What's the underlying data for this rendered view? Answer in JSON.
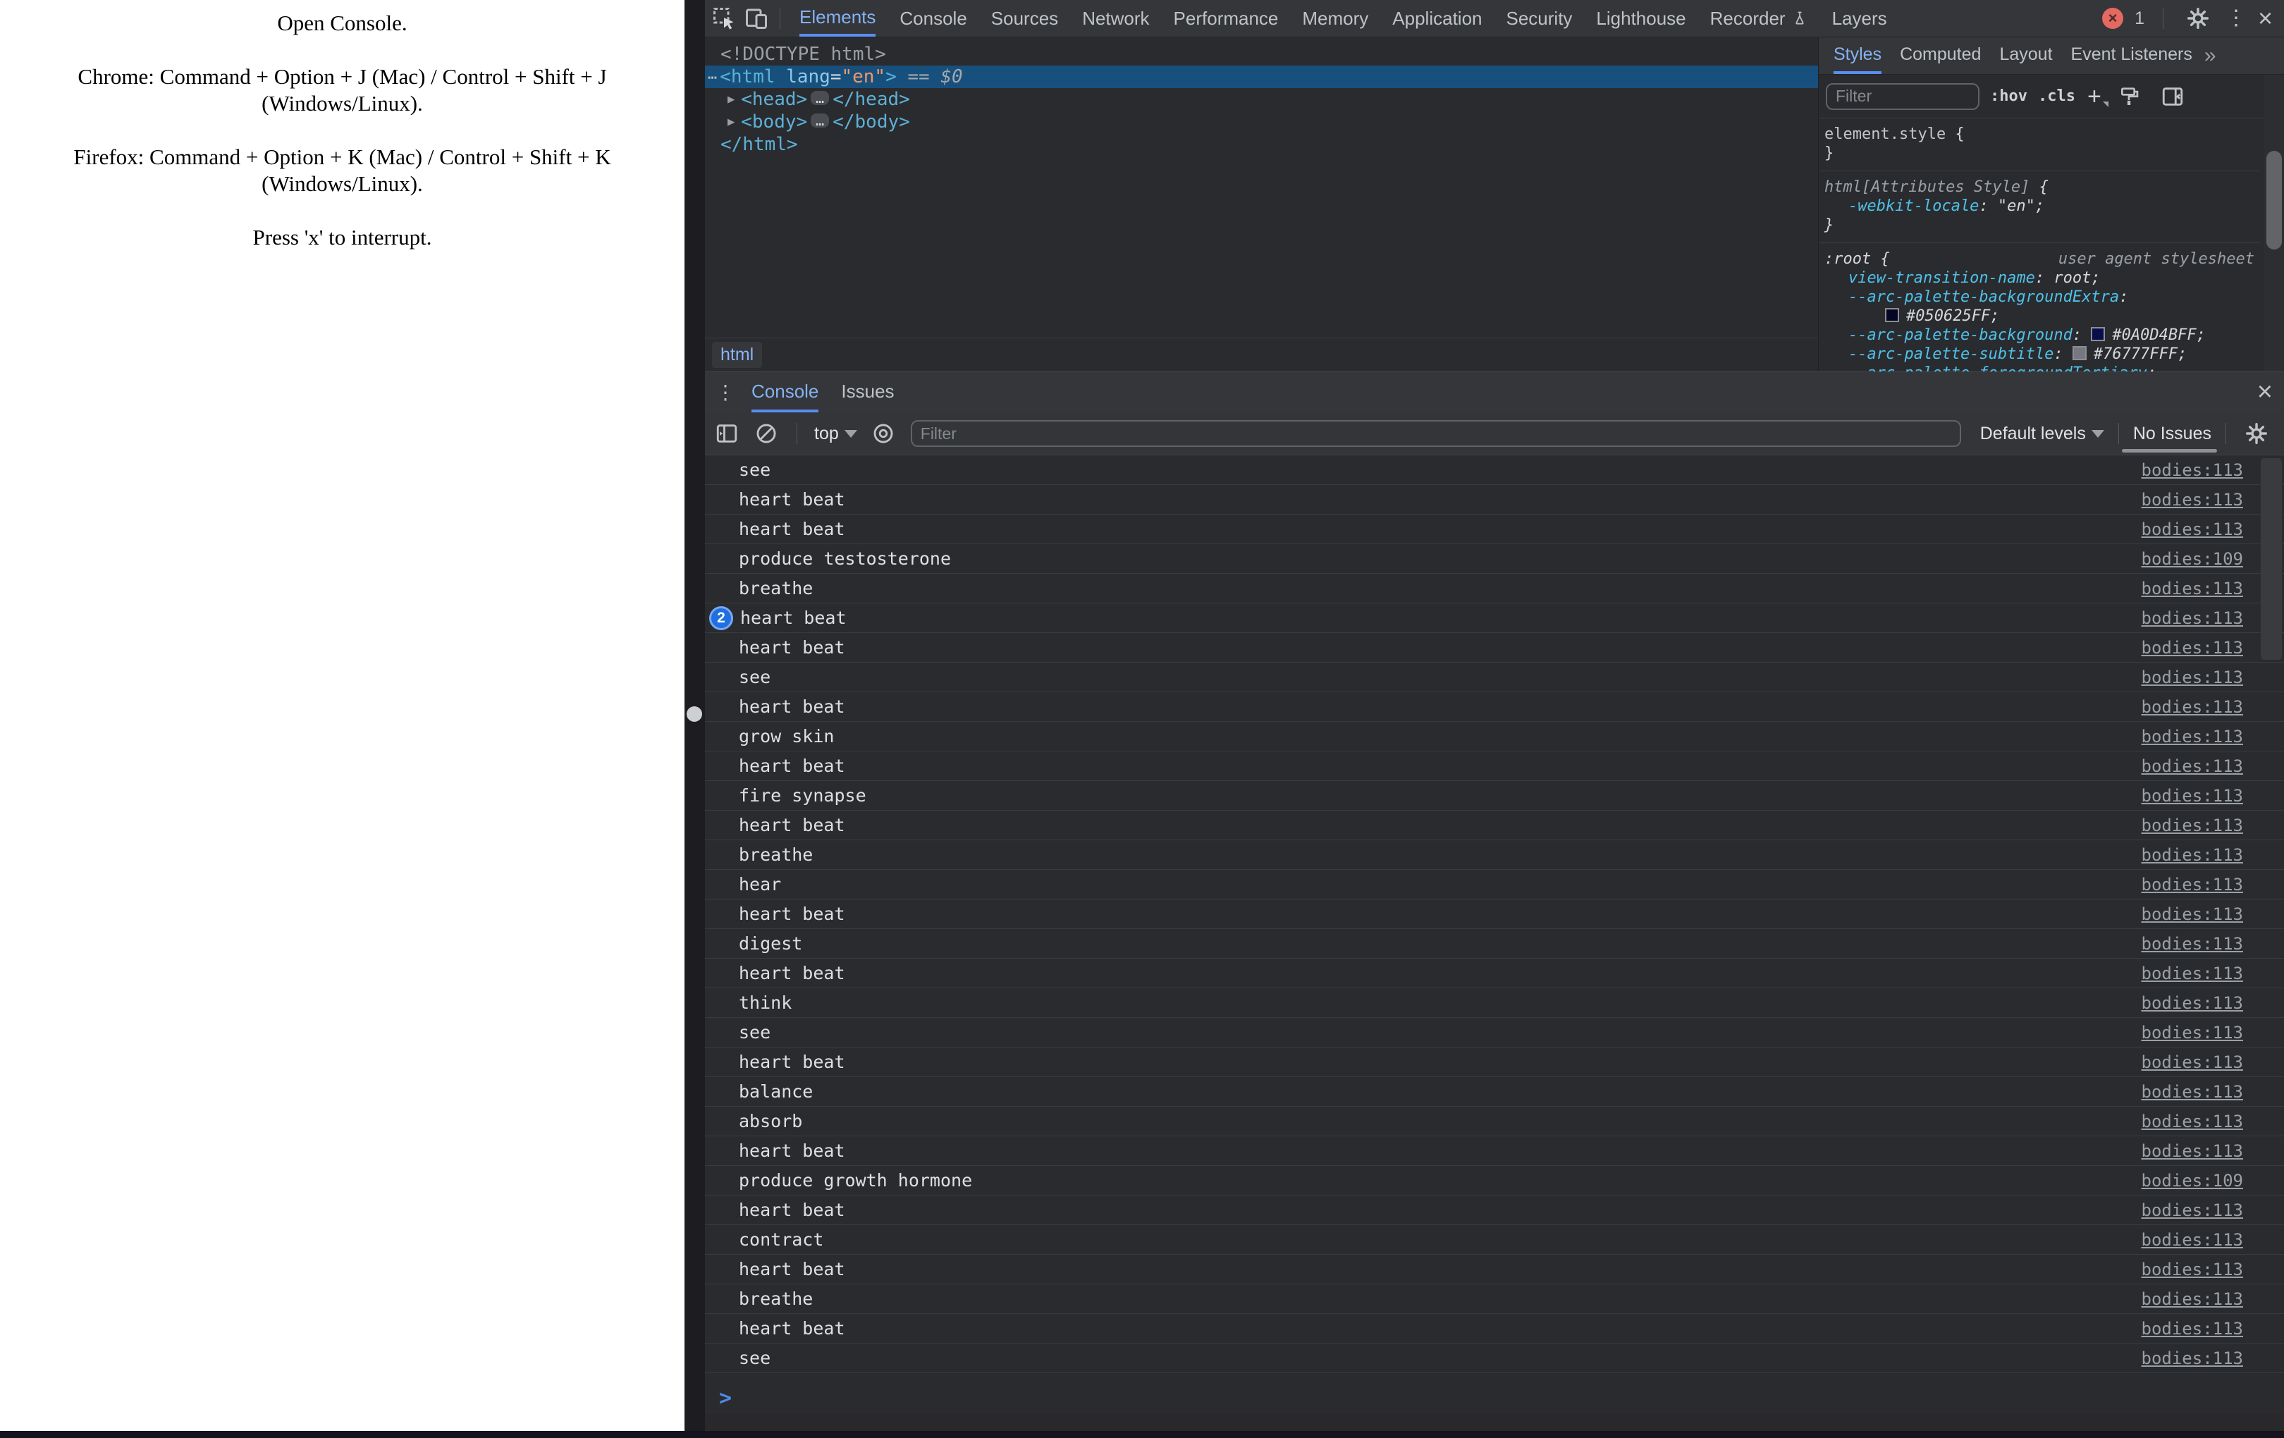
{
  "page": {
    "paragraphs": [
      [
        "Open Console."
      ],
      [
        "Chrome: Command + Option + J (Mac) / Control + Shift + J",
        "(Windows/Linux)."
      ],
      [
        "Firefox: Command + Option + K (Mac) / Control + Shift + K",
        "(Windows/Linux)."
      ],
      [
        "Press 'x' to interrupt."
      ]
    ]
  },
  "colors": {
    "accent_blue": "#8ab4f8",
    "selection_blue": "#17507c",
    "tag_blue": "#5db0d7",
    "value_orange": "#f29766",
    "property_cyan": "#4fc1e9",
    "error_red": "#e46962",
    "badge_blue": "#1f6fe0"
  },
  "devtools": {
    "tabs": [
      "Elements",
      "Console",
      "Sources",
      "Network",
      "Performance",
      "Memory",
      "Application",
      "Security",
      "Lighthouse",
      "Recorder",
      "Layers"
    ],
    "active_tab": "Elements",
    "error_count": "1",
    "elements": {
      "breadcrumb": "html",
      "dom_lines": [
        {
          "ind": 0,
          "sel": false,
          "tokens": [
            {
              "c": "gray",
              "t": "<!DOCTYPE html>"
            }
          ]
        },
        {
          "ind": 0,
          "sel": true,
          "tokens": [
            {
              "c": "dots",
              "t": "⋯"
            },
            {
              "c": "tag",
              "t": "<html"
            },
            {
              "c": "plain",
              "t": " "
            },
            {
              "c": "attr",
              "t": "lang"
            },
            {
              "c": "plain",
              "t": "="
            },
            {
              "c": "value",
              "t": "\"en\""
            },
            {
              "c": "tag",
              "t": ">"
            },
            {
              "c": "anno",
              "t": " == $0"
            }
          ]
        },
        {
          "ind": 1,
          "sel": false,
          "tokens": [
            {
              "c": "arrow",
              "t": "▶"
            },
            {
              "c": "tag",
              "t": "<head>"
            },
            {
              "c": "pill",
              "t": "…"
            },
            {
              "c": "tag",
              "t": "</head>"
            }
          ]
        },
        {
          "ind": 1,
          "sel": false,
          "tokens": [
            {
              "c": "arrow",
              "t": "▶"
            },
            {
              "c": "tag",
              "t": "<body>"
            },
            {
              "c": "pill",
              "t": "…"
            },
            {
              "c": "tag",
              "t": "</body>"
            }
          ]
        },
        {
          "ind": 0,
          "sel": false,
          "tokens": [
            {
              "c": "tag",
              "t": "</html>"
            }
          ]
        }
      ]
    },
    "styles_sidebar": {
      "tabs": [
        "Styles",
        "Computed",
        "Layout",
        "Event Listeners"
      ],
      "active_tab": "Styles",
      "overflow_chevron": "»",
      "filter_placeholder": "Filter",
      "pseudo_toggle": ":hov",
      "class_toggle": ".cls",
      "rules": [
        {
          "italic": false,
          "note": "",
          "lines": [
            {
              "ind": 0,
              "tokens": [
                {
                  "c": "selgray",
                  "t": "element.style"
                },
                {
                  "c": "plain",
                  "t": " {"
                }
              ]
            },
            {
              "ind": 0,
              "tokens": [
                {
                  "c": "plain",
                  "t": "}"
                }
              ]
            }
          ]
        },
        {
          "italic": true,
          "note": "",
          "lines": [
            {
              "ind": 0,
              "tokens": [
                {
                  "c": "sel",
                  "t": "html[Attributes Style]"
                },
                {
                  "c": "plain",
                  "t": " {"
                }
              ]
            },
            {
              "ind": 1,
              "tokens": [
                {
                  "c": "prop",
                  "t": "-webkit-locale"
                },
                {
                  "c": "plain",
                  "t": ": \"en\";"
                }
              ]
            },
            {
              "ind": 0,
              "tokens": [
                {
                  "c": "plain",
                  "t": "}"
                }
              ]
            }
          ]
        },
        {
          "italic": true,
          "note": "user agent stylesheet",
          "lines": [
            {
              "ind": 0,
              "tokens": [
                {
                  "c": "selroot",
                  "t": ":root"
                },
                {
                  "c": "plain",
                  "t": " {"
                }
              ]
            },
            {
              "ind": 1,
              "tokens": [
                {
                  "c": "prop",
                  "t": "view-transition-name"
                },
                {
                  "c": "plain",
                  "t": ": root;"
                }
              ]
            },
            {
              "ind": 1,
              "tokens": [
                {
                  "c": "prop",
                  "t": "--arc-palette-backgroundExtra"
                },
                {
                  "c": "plain",
                  "t": ":"
                }
              ]
            },
            {
              "ind": 2,
              "tokens": [
                {
                  "c": "swatch",
                  "t": "#050625"
                },
                {
                  "c": "plain",
                  "t": "#050625FF;"
                }
              ]
            },
            {
              "ind": 1,
              "tokens": [
                {
                  "c": "prop",
                  "t": "--arc-palette-background"
                },
                {
                  "c": "plain",
                  "t": ": "
                },
                {
                  "c": "swatch",
                  "t": "#0A0D4B"
                },
                {
                  "c": "plain",
                  "t": "#0A0D4BFF;"
                }
              ]
            },
            {
              "ind": 1,
              "tokens": [
                {
                  "c": "prop",
                  "t": "--arc-palette-subtitle"
                },
                {
                  "c": "plain",
                  "t": ": "
                },
                {
                  "c": "swatch",
                  "t": "#76777F"
                },
                {
                  "c": "plain",
                  "t": "#76777FFF;"
                }
              ]
            },
            {
              "ind": 1,
              "tokens": [
                {
                  "c": "prop",
                  "t": "--arc-palette-foregroundTertiary"
                },
                {
                  "c": "plain",
                  "t": ":"
                }
              ]
            }
          ]
        }
      ]
    },
    "console": {
      "tabs": [
        "Console",
        "Issues"
      ],
      "active_tab": "Console",
      "context_selector": "top",
      "filter_placeholder": "Filter",
      "levels_label": "Default levels",
      "issues_label": "No Issues",
      "prompt": ">",
      "messages": [
        {
          "t": "see",
          "l": "bodies:113",
          "b": ""
        },
        {
          "t": "heart beat",
          "l": "bodies:113",
          "b": ""
        },
        {
          "t": "heart beat",
          "l": "bodies:113",
          "b": ""
        },
        {
          "t": "produce testosterone",
          "l": "bodies:109",
          "b": ""
        },
        {
          "t": "breathe",
          "l": "bodies:113",
          "b": ""
        },
        {
          "t": "heart beat",
          "l": "bodies:113",
          "b": "2"
        },
        {
          "t": "heart beat",
          "l": "bodies:113",
          "b": ""
        },
        {
          "t": "see",
          "l": "bodies:113",
          "b": ""
        },
        {
          "t": "heart beat",
          "l": "bodies:113",
          "b": ""
        },
        {
          "t": "grow skin",
          "l": "bodies:113",
          "b": ""
        },
        {
          "t": "heart beat",
          "l": "bodies:113",
          "b": ""
        },
        {
          "t": "fire synapse",
          "l": "bodies:113",
          "b": ""
        },
        {
          "t": "heart beat",
          "l": "bodies:113",
          "b": ""
        },
        {
          "t": "breathe",
          "l": "bodies:113",
          "b": ""
        },
        {
          "t": "hear",
          "l": "bodies:113",
          "b": ""
        },
        {
          "t": "heart beat",
          "l": "bodies:113",
          "b": ""
        },
        {
          "t": "digest",
          "l": "bodies:113",
          "b": ""
        },
        {
          "t": "heart beat",
          "l": "bodies:113",
          "b": ""
        },
        {
          "t": "think",
          "l": "bodies:113",
          "b": ""
        },
        {
          "t": "see",
          "l": "bodies:113",
          "b": ""
        },
        {
          "t": "heart beat",
          "l": "bodies:113",
          "b": ""
        },
        {
          "t": "balance",
          "l": "bodies:113",
          "b": ""
        },
        {
          "t": "absorb",
          "l": "bodies:113",
          "b": ""
        },
        {
          "t": "heart beat",
          "l": "bodies:113",
          "b": ""
        },
        {
          "t": "produce growth hormone",
          "l": "bodies:109",
          "b": ""
        },
        {
          "t": "heart beat",
          "l": "bodies:113",
          "b": ""
        },
        {
          "t": "contract",
          "l": "bodies:113",
          "b": ""
        },
        {
          "t": "heart beat",
          "l": "bodies:113",
          "b": ""
        },
        {
          "t": "breathe",
          "l": "bodies:113",
          "b": ""
        },
        {
          "t": "heart beat",
          "l": "bodies:113",
          "b": ""
        },
        {
          "t": "see",
          "l": "bodies:113",
          "b": ""
        }
      ]
    }
  }
}
